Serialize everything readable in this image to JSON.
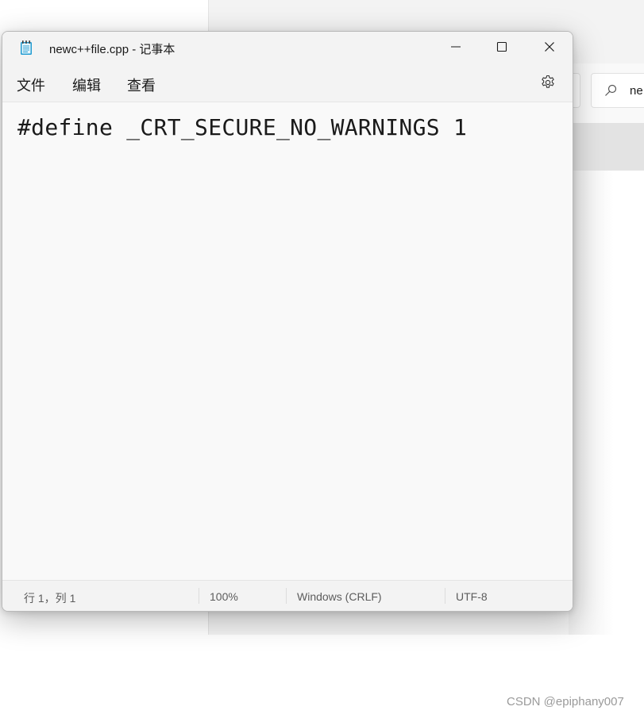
{
  "window": {
    "title": "newc++file.cpp - 记事本",
    "icon": "notepad-icon",
    "controls": {
      "minimize": "minimize-icon",
      "maximize": "maximize-icon",
      "close": "close-icon"
    }
  },
  "menu": {
    "items": [
      {
        "label": "文件"
      },
      {
        "label": "编辑"
      },
      {
        "label": "查看"
      }
    ],
    "settings_icon": "gear-icon"
  },
  "editor": {
    "content": "#define _CRT_SECURE_NO_WARNINGS 1"
  },
  "statusbar": {
    "position": "行 1，列 1",
    "zoom": "100%",
    "line_ending": "Windows (CRLF)",
    "encoding": "UTF-8"
  },
  "background_window": {
    "search_text": "ne",
    "search_icon": "search-icon"
  },
  "watermark": "CSDN @epiphany007"
}
